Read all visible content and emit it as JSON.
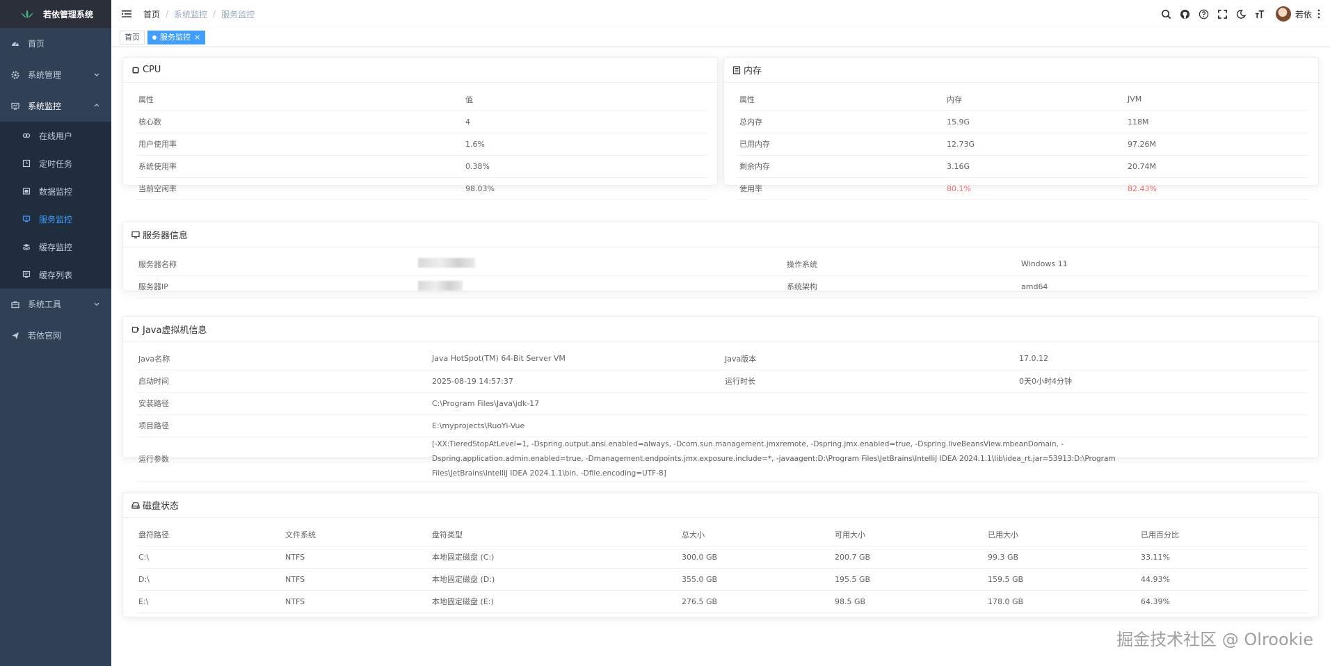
{
  "app": {
    "title": "若依管理系统"
  },
  "sidebar": {
    "items": [
      {
        "label": "首页",
        "icon": "dashboard-icon"
      },
      {
        "label": "系统管理",
        "icon": "gear-icon"
      },
      {
        "label": "系统监控",
        "icon": "monitor-icon"
      },
      {
        "label": "系统工具",
        "icon": "toolbox-icon"
      },
      {
        "label": "若依官网",
        "icon": "send-icon"
      }
    ],
    "submenu": [
      {
        "label": "在线用户",
        "icon": "online-icon"
      },
      {
        "label": "定时任务",
        "icon": "job-icon"
      },
      {
        "label": "数据监控",
        "icon": "druid-icon"
      },
      {
        "label": "服务监控",
        "icon": "server-icon",
        "active": true
      },
      {
        "label": "缓存监控",
        "icon": "redis-icon"
      },
      {
        "label": "缓存列表",
        "icon": "redis-list-icon"
      }
    ]
  },
  "navbar": {
    "breadcrumb": [
      "首页",
      "系统监控",
      "服务监控"
    ],
    "username": "若依"
  },
  "tags": {
    "home": "首页",
    "active": "服务监控",
    "close": "×"
  },
  "cpu": {
    "title": "CPU",
    "headers": [
      "属性",
      "值"
    ],
    "rows": [
      [
        "核心数",
        "4"
      ],
      [
        "用户使用率",
        "1.6%"
      ],
      [
        "系统使用率",
        "0.38%"
      ],
      [
        "当前空闲率",
        "98.03%"
      ]
    ]
  },
  "memory": {
    "title": "内存",
    "headers": [
      "属性",
      "内存",
      "JVM"
    ],
    "rows": [
      [
        "总内存",
        "15.9G",
        "118M"
      ],
      [
        "已用内存",
        "12.73G",
        "97.26M"
      ],
      [
        "剩余内存",
        "3.16G",
        "20.74M"
      ],
      [
        "使用率",
        "80.1%",
        "82.43%"
      ]
    ]
  },
  "server": {
    "title": "服务器信息",
    "rows": [
      [
        "服务器名称",
        "",
        "操作系统",
        "Windows 11"
      ],
      [
        "服务器IP",
        "",
        "系统架构",
        "amd64"
      ]
    ]
  },
  "jvm": {
    "title": "Java虚拟机信息",
    "rows": [
      [
        "Java名称",
        "Java HotSpot(TM) 64-Bit Server VM",
        "Java版本",
        "17.0.12"
      ],
      [
        "启动时间",
        "2025-08-19 14:57:37",
        "运行时长",
        "0天0小时4分钟"
      ]
    ],
    "full_rows": [
      [
        "安装路径",
        "C:\\Program Files\\Java\\jdk-17"
      ],
      [
        "项目路径",
        "E:\\myprojects\\RuoYi-Vue"
      ],
      [
        "运行参数",
        "[-XX:TieredStopAtLevel=1, -Dspring.output.ansi.enabled=always, -Dcom.sun.management.jmxremote, -Dspring.jmx.enabled=true, -Dspring.liveBeansView.mbeanDomain, -Dspring.application.admin.enabled=true, -Dmanagement.endpoints.jmx.exposure.include=*, -javaagent:D:\\Program Files\\JetBrains\\IntelliJ IDEA 2024.1.1\\lib\\idea_rt.jar=53913:D:\\Program Files\\JetBrains\\IntelliJ IDEA 2024.1.1\\bin, -Dfile.encoding=UTF-8]"
      ]
    ]
  },
  "disk": {
    "title": "磁盘状态",
    "headers": [
      "盘符路径",
      "文件系统",
      "盘符类型",
      "总大小",
      "可用大小",
      "已用大小",
      "已用百分比"
    ],
    "rows": [
      [
        "C:\\",
        "NTFS",
        "本地固定磁盘 (C:)",
        "300.0 GB",
        "200.7 GB",
        "99.3 GB",
        "33.11%"
      ],
      [
        "D:\\",
        "NTFS",
        "本地固定磁盘 (D:)",
        "355.0 GB",
        "195.5 GB",
        "159.5 GB",
        "44.93%"
      ],
      [
        "E:\\",
        "NTFS",
        "本地固定磁盘 (E:)",
        "276.5 GB",
        "98.5 GB",
        "178.0 GB",
        "64.39%"
      ]
    ]
  },
  "watermark": "掘金技术社区 @ Olrookie",
  "colors": {
    "sidebar_bg": "#304156",
    "submenu_bg": "#1f2d3d",
    "accent": "#409eff",
    "danger": "#f56c6c"
  }
}
